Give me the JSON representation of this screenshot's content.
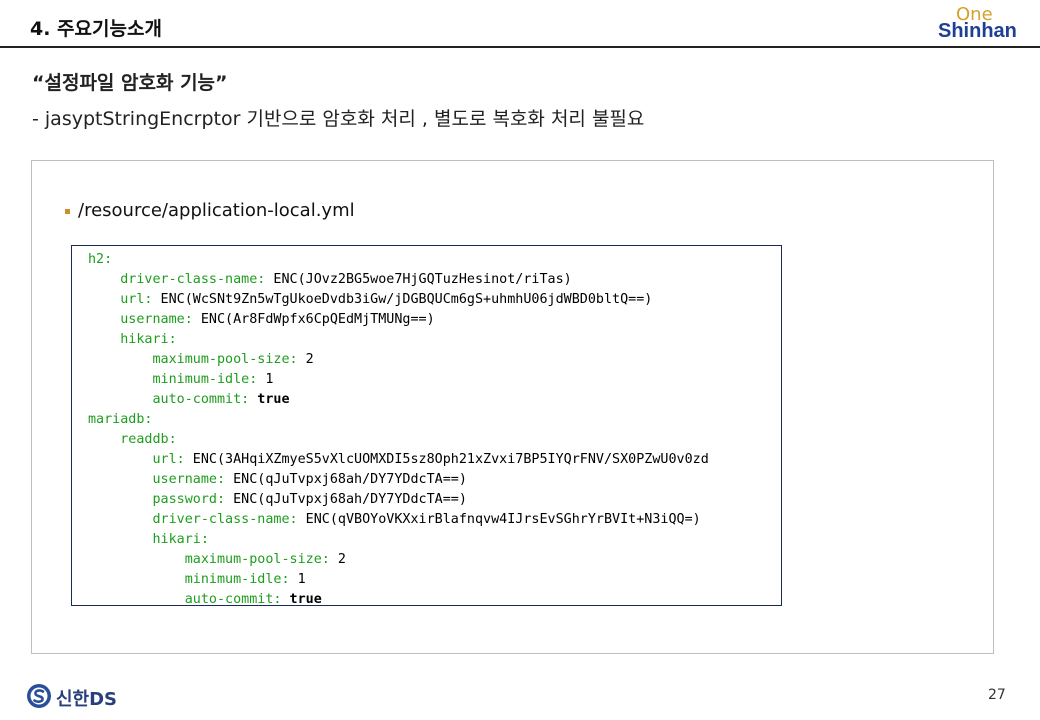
{
  "header": {
    "title": "4. 주요기능소개",
    "logo_top": "One",
    "logo_bottom": "Shinhan",
    "logo_colors": {
      "one": "#d4a22a",
      "shinhan": "#1f3f93"
    }
  },
  "section": {
    "title": "“설정파일 암호화 기능”",
    "description": "- jasyptStringEncrptor  기반으로 암호화 처리 , 별도로 복호화 처리 불필요"
  },
  "panel": {
    "file_path": "/resource/application-local.yml",
    "code_lines": [
      {
        "indent": "",
        "key": "h2:",
        "value": "",
        "bold": false
      },
      {
        "indent": "    ",
        "key": "driver-class-name:",
        "value": " ENC(JOvz2BG5woe7HjGQTuzHesinot/riTas)",
        "bold": false
      },
      {
        "indent": "    ",
        "key": "url:",
        "value": " ENC(WcSNt9Zn5wTgUkoeDvdb3iGw/jDGBQUCm6gS+uhmhU06jdWBD0bltQ==)",
        "bold": false
      },
      {
        "indent": "    ",
        "key": "username:",
        "value": " ENC(Ar8FdWpfx6CpQEdMjTMUNg==)",
        "bold": false
      },
      {
        "indent": "    ",
        "key": "hikari:",
        "value": "",
        "bold": false
      },
      {
        "indent": "        ",
        "key": "maximum-pool-size:",
        "value": " 2",
        "bold": false
      },
      {
        "indent": "        ",
        "key": "minimum-idle:",
        "value": " 1",
        "bold": false
      },
      {
        "indent": "        ",
        "key": "auto-commit:",
        "value": " true",
        "bold": true
      },
      {
        "indent": "",
        "key": "mariadb:",
        "value": "",
        "bold": false
      },
      {
        "indent": "    ",
        "key": "readdb:",
        "value": "",
        "bold": false
      },
      {
        "indent": "        ",
        "key": "url:",
        "value": " ENC(3AHqiXZmyeS5vXlcUOMXDI5sz8Oph21xZvxi7BP5IYQrFNV/SX0PZwU0v0zd",
        "bold": false
      },
      {
        "indent": "        ",
        "key": "username:",
        "value": " ENC(qJuTvpxj68ah/DY7YDdcTA==)",
        "bold": false
      },
      {
        "indent": "        ",
        "key": "password:",
        "value": " ENC(qJuTvpxj68ah/DY7YDdcTA==)",
        "bold": false
      },
      {
        "indent": "        ",
        "key": "driver-class-name:",
        "value": " ENC(qVBOYoVKXxirBlafnqvw4IJrsEvSGhrYrBVIt+N3iQQ=)",
        "bold": false
      },
      {
        "indent": "        ",
        "key": "hikari:",
        "value": "",
        "bold": false
      },
      {
        "indent": "            ",
        "key": "maximum-pool-size:",
        "value": " 2",
        "bold": false
      },
      {
        "indent": "            ",
        "key": "minimum-idle:",
        "value": " 1",
        "bold": false
      },
      {
        "indent": "            ",
        "key": "auto-commit:",
        "value": " true",
        "bold": true
      }
    ],
    "colors": {
      "key": "#1f9d1f",
      "border": "#1b2a5c",
      "bullet": "#c8912b"
    }
  },
  "footer": {
    "logo_text": "신한DS",
    "logo_icon": "shinhan-s-logo-icon",
    "page_number": "27"
  }
}
